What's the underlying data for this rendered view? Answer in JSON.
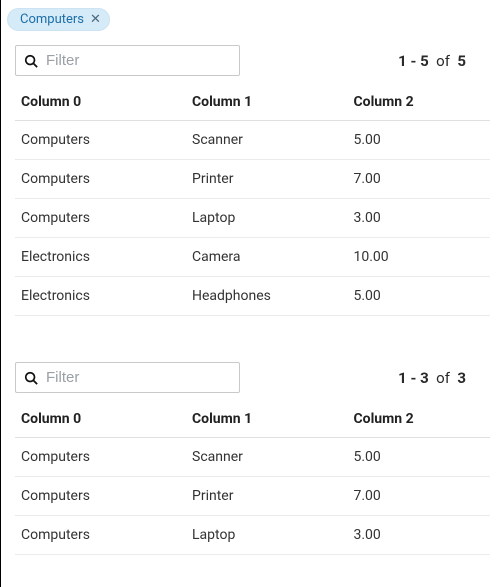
{
  "filter_chip": {
    "label": "Computers"
  },
  "tables": [
    {
      "filter_placeholder": "Filter",
      "pagination": {
        "range": "1 - 5",
        "of_word": "of",
        "total": "5"
      },
      "headers": [
        "Column 0",
        "Column 1",
        "Column 2"
      ],
      "rows": [
        [
          "Computers",
          "Scanner",
          "5.00"
        ],
        [
          "Computers",
          "Printer",
          "7.00"
        ],
        [
          "Computers",
          "Laptop",
          "3.00"
        ],
        [
          "Electronics",
          "Camera",
          "10.00"
        ],
        [
          "Electronics",
          "Headphones",
          "5.00"
        ]
      ]
    },
    {
      "filter_placeholder": "Filter",
      "pagination": {
        "range": "1 - 3",
        "of_word": "of",
        "total": "3"
      },
      "headers": [
        "Column 0",
        "Column 1",
        "Column 2"
      ],
      "rows": [
        [
          "Computers",
          "Scanner",
          "5.00"
        ],
        [
          "Computers",
          "Printer",
          "7.00"
        ],
        [
          "Computers",
          "Laptop",
          "3.00"
        ]
      ]
    }
  ]
}
